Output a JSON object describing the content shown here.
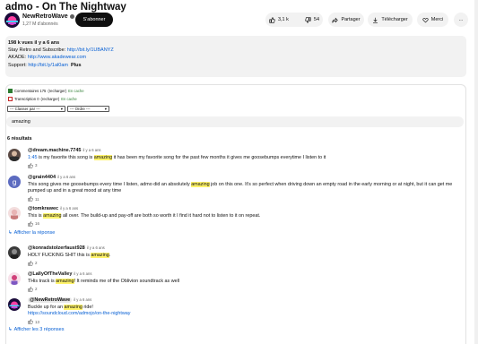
{
  "video": {
    "title": "admo - On The Nightway",
    "channel_name": "NewRetroWave",
    "subscribers": "1,27 M d'abonnés",
    "subscribe_label": "S'abonner",
    "likes": "3,1 k",
    "dislikes": "54",
    "share_label": "Partager",
    "download_label": "Télécharger",
    "thanks_label": "Merci",
    "more_label": "…"
  },
  "description": {
    "stats": "198 k vues  il y a 6 ans",
    "line1_prefix": "Stay Retro and Subscribe: ",
    "line1_link": "http://bit.ly/1UBANYZ",
    "line2_prefix": "AKADE: ",
    "line2_link": "http://www.akadewear.com",
    "line3_prefix": "Support: ",
    "line3_link": "http://bit.ly/1al0am",
    "more_label": "Plus"
  },
  "options": {
    "comments_label": "Commentaires 175",
    "comments_status": "(recharger)",
    "comments_cache": "En cache",
    "transcript_label": "Transcription  0",
    "transcript_status": "(recharger)",
    "transcript_cache": "En cache",
    "sort_placeholder": "--- Classer par ---",
    "order_placeholder": "--- Ordre ---"
  },
  "search": {
    "query": "amazing"
  },
  "results_count": "6 résultats",
  "comments": [
    {
      "author": "@dream.machine.7745",
      "date": "il y a 6 ans",
      "timestamp": "1:45",
      "pre": " is my favorite this song is ",
      "highlight": "amazing",
      "post": " it has been my favorite song for the past few months it gives me goosebumps everytime I listen to it",
      "likes": "3"
    },
    {
      "author": "@grain4404",
      "date": "il y a 6 ans",
      "pre": "This song gives me goosebumps every time I listen, admo did an absolutely ",
      "highlight": "amazing",
      "post": " job on this one. It's so perfect when driving down an empty road in the early morning or at night, but it can get me pumped up and in a great mood at any time",
      "likes": "11"
    },
    {
      "author": "@tomkrawec",
      "date": "il y a 6 ans",
      "pre": "This is ",
      "highlight": "amazing",
      "post": " all over. The build-up and pay-off are both so worth it I find it hard not to listen to it on repeat.",
      "likes": "16"
    },
    {
      "author": "@konradstolzerfaust928",
      "date": "il y a 6 ans",
      "pre": "HOLY FUCKING SHIT this is ",
      "highlight": "amazing",
      "post": ".",
      "likes": "2"
    },
    {
      "author": "@LallyOfTheValley",
      "date": "il y a 6 ans",
      "pre": "THis track is ",
      "highlight": "amazing",
      "post": "! It reminds me of the Oblivion soundtrack as well",
      "likes": "2"
    },
    {
      "author": "@NewRetroWave",
      "date": "il y a 6 ans",
      "pre": "Buckle up for an ",
      "highlight": "amazing",
      "post": " ride!",
      "link": "https://soundcloud.com/admojo/on-the-nightway",
      "likes": "13"
    }
  ],
  "reply_links": {
    "show_reply": "Afficher la réponse",
    "show_replies": "Afficher les 3 réponses"
  },
  "colors": {
    "accent": "#065fd4",
    "highlight": "#fef36a",
    "subscribe_bg": "#0f0f0f"
  }
}
